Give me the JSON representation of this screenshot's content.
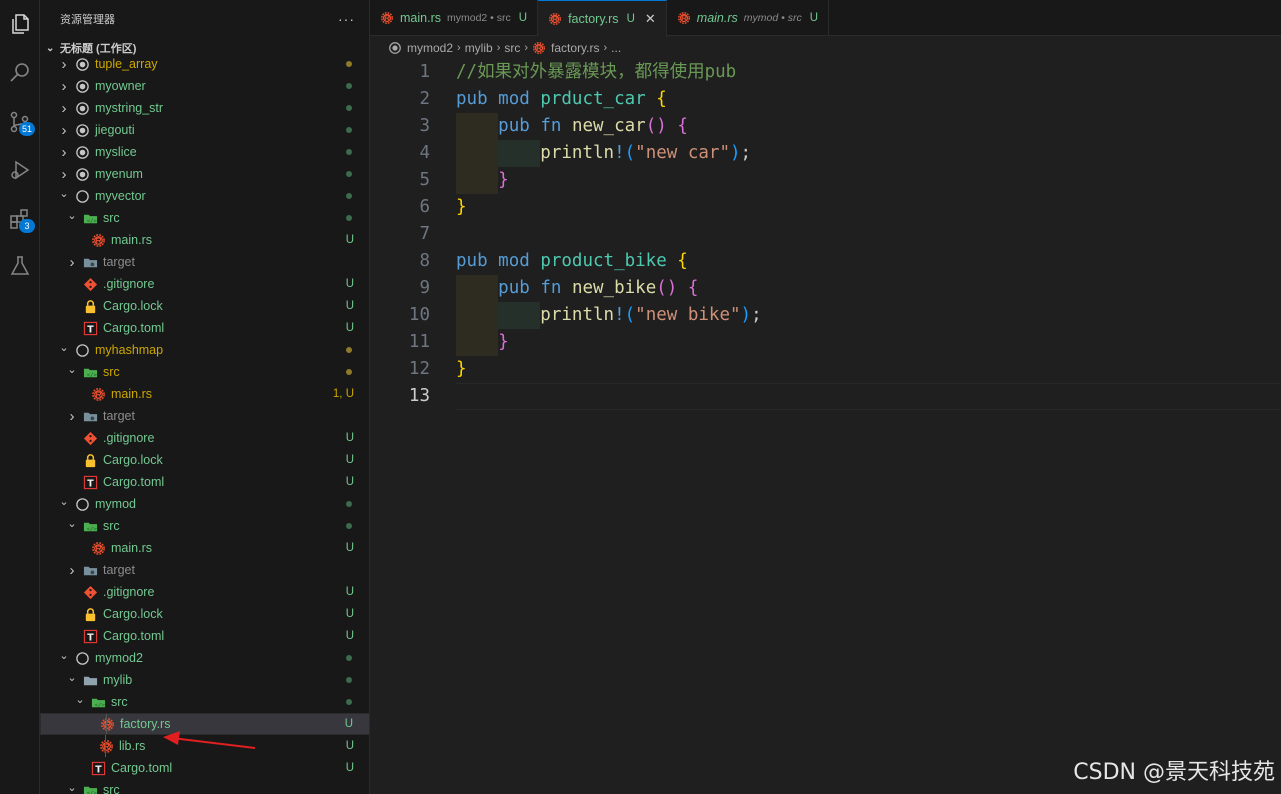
{
  "sidebar": {
    "title": "资源管理器",
    "more": "···",
    "workspace": "无标题 (工作区)",
    "tree": [
      {
        "label": "tuple_array",
        "depth": 0,
        "arrow": "right",
        "icon": "crate",
        "color": "yellow",
        "status": "",
        "dot": "yellow"
      },
      {
        "label": "myowner",
        "depth": 0,
        "arrow": "right",
        "icon": "crate",
        "color": "green",
        "status": "",
        "dot": "green"
      },
      {
        "label": "mystring_str",
        "depth": 0,
        "arrow": "right",
        "icon": "crate",
        "color": "green",
        "status": "",
        "dot": "green"
      },
      {
        "label": "jiegouti",
        "depth": 0,
        "arrow": "right",
        "icon": "crate",
        "color": "green",
        "status": "",
        "dot": "green"
      },
      {
        "label": "myslice",
        "depth": 0,
        "arrow": "right",
        "icon": "crate",
        "color": "green",
        "status": "",
        "dot": "green"
      },
      {
        "label": "myenum",
        "depth": 0,
        "arrow": "right",
        "icon": "crate",
        "color": "green",
        "status": "",
        "dot": "green"
      },
      {
        "label": "myvector",
        "depth": 0,
        "arrow": "down",
        "icon": "crate-open",
        "color": "green",
        "status": "",
        "dot": "green"
      },
      {
        "label": "src",
        "depth": 1,
        "arrow": "down",
        "icon": "folder-src",
        "color": "green",
        "status": "",
        "dot": "green"
      },
      {
        "label": "main.rs",
        "depth": 2,
        "arrow": "",
        "icon": "rust",
        "color": "green",
        "status": "U",
        "dot": ""
      },
      {
        "label": "target",
        "depth": 1,
        "arrow": "right",
        "icon": "folder-target",
        "color": "gray",
        "status": "",
        "dot": ""
      },
      {
        "label": ".gitignore",
        "depth": 1,
        "arrow": "",
        "icon": "git",
        "color": "green",
        "status": "U",
        "dot": ""
      },
      {
        "label": "Cargo.lock",
        "depth": 1,
        "arrow": "",
        "icon": "lock",
        "color": "green",
        "status": "U",
        "dot": ""
      },
      {
        "label": "Cargo.toml",
        "depth": 1,
        "arrow": "",
        "icon": "toml",
        "color": "green",
        "status": "U",
        "dot": ""
      },
      {
        "label": "myhashmap",
        "depth": 0,
        "arrow": "down",
        "icon": "crate-open",
        "color": "yellow",
        "status": "",
        "dot": "yellow"
      },
      {
        "label": "src",
        "depth": 1,
        "arrow": "down",
        "icon": "folder-src",
        "color": "yellow",
        "status": "",
        "dot": "yellow"
      },
      {
        "label": "main.rs",
        "depth": 2,
        "arrow": "",
        "icon": "rust",
        "color": "yellow",
        "status": "1, U",
        "dot": ""
      },
      {
        "label": "target",
        "depth": 1,
        "arrow": "right",
        "icon": "folder-target",
        "color": "gray",
        "status": "",
        "dot": ""
      },
      {
        "label": ".gitignore",
        "depth": 1,
        "arrow": "",
        "icon": "git",
        "color": "green",
        "status": "U",
        "dot": ""
      },
      {
        "label": "Cargo.lock",
        "depth": 1,
        "arrow": "",
        "icon": "lock",
        "color": "green",
        "status": "U",
        "dot": ""
      },
      {
        "label": "Cargo.toml",
        "depth": 1,
        "arrow": "",
        "icon": "toml",
        "color": "green",
        "status": "U",
        "dot": ""
      },
      {
        "label": "mymod",
        "depth": 0,
        "arrow": "down",
        "icon": "crate-open",
        "color": "green",
        "status": "",
        "dot": "green"
      },
      {
        "label": "src",
        "depth": 1,
        "arrow": "down",
        "icon": "folder-src",
        "color": "green",
        "status": "",
        "dot": "green"
      },
      {
        "label": "main.rs",
        "depth": 2,
        "arrow": "",
        "icon": "rust",
        "color": "green",
        "status": "U",
        "dot": ""
      },
      {
        "label": "target",
        "depth": 1,
        "arrow": "right",
        "icon": "folder-target",
        "color": "gray",
        "status": "",
        "dot": ""
      },
      {
        "label": ".gitignore",
        "depth": 1,
        "arrow": "",
        "icon": "git",
        "color": "green",
        "status": "U",
        "dot": ""
      },
      {
        "label": "Cargo.lock",
        "depth": 1,
        "arrow": "",
        "icon": "lock",
        "color": "green",
        "status": "U",
        "dot": ""
      },
      {
        "label": "Cargo.toml",
        "depth": 1,
        "arrow": "",
        "icon": "toml",
        "color": "green",
        "status": "U",
        "dot": ""
      },
      {
        "label": "mymod2",
        "depth": 0,
        "arrow": "down",
        "icon": "crate-open",
        "color": "green",
        "status": "",
        "dot": "green"
      },
      {
        "label": "mylib",
        "depth": 1,
        "arrow": "down",
        "icon": "folder-open",
        "color": "green",
        "status": "",
        "dot": "green"
      },
      {
        "label": "src",
        "depth": 2,
        "arrow": "down",
        "icon": "folder-src",
        "color": "green",
        "status": "",
        "dot": "green"
      },
      {
        "label": "factory.rs",
        "depth": 3,
        "arrow": "",
        "icon": "rust",
        "color": "green",
        "status": "U",
        "dot": "",
        "selected": true
      },
      {
        "label": "lib.rs",
        "depth": 3,
        "arrow": "",
        "icon": "rust",
        "color": "green",
        "status": "U",
        "dot": ""
      },
      {
        "label": "Cargo.toml",
        "depth": 2,
        "arrow": "",
        "icon": "toml",
        "color": "green",
        "status": "U",
        "dot": ""
      },
      {
        "label": "src",
        "depth": 1,
        "arrow": "down",
        "icon": "folder-src",
        "color": "green",
        "status": "",
        "dot": ""
      }
    ]
  },
  "activity": {
    "scm_badge": "51",
    "ext_badge": "3"
  },
  "tabs": [
    {
      "label": "main.rs",
      "desc": "mymod2 • src",
      "status": "U",
      "active": false,
      "italic": false
    },
    {
      "label": "factory.rs",
      "desc": "",
      "status": "U",
      "active": true,
      "italic": false,
      "close": "✕"
    },
    {
      "label": "main.rs",
      "desc": "mymod • src",
      "status": "U",
      "active": false,
      "italic": true
    }
  ],
  "breadcrumb": [
    "mymod2",
    "mylib",
    "src",
    "factory.rs",
    "..."
  ],
  "editor": {
    "current_line": 13,
    "lines": [
      [
        {
          "t": "//如果对外暴露模块，都得使用pub",
          "c": "cm"
        }
      ],
      [
        {
          "t": "pub",
          "c": "k"
        },
        {
          "t": " "
        },
        {
          "t": "mod",
          "c": "k"
        },
        {
          "t": " "
        },
        {
          "t": "prduct_car",
          "c": "t"
        },
        {
          "t": " "
        },
        {
          "t": "{",
          "c": "b1"
        }
      ],
      [
        {
          "t": "    "
        },
        {
          "t": "pub",
          "c": "k"
        },
        {
          "t": " "
        },
        {
          "t": "fn",
          "c": "k"
        },
        {
          "t": " "
        },
        {
          "t": "new_car",
          "c": "f"
        },
        {
          "t": "()",
          "c": "b2"
        },
        {
          "t": " "
        },
        {
          "t": "{",
          "c": "b2"
        }
      ],
      [
        {
          "t": "        "
        },
        {
          "t": "println",
          "c": "f"
        },
        {
          "t": "!",
          "c": "mac"
        },
        {
          "t": "(",
          "c": "b3"
        },
        {
          "t": "\"new car\"",
          "c": "s"
        },
        {
          "t": ")",
          "c": "b3"
        },
        {
          "t": ";"
        }
      ],
      [
        {
          "t": "    "
        },
        {
          "t": "}",
          "c": "b2"
        }
      ],
      [
        {
          "t": "}",
          "c": "b1"
        }
      ],
      [],
      [
        {
          "t": "pub",
          "c": "k"
        },
        {
          "t": " "
        },
        {
          "t": "mod",
          "c": "k"
        },
        {
          "t": " "
        },
        {
          "t": "product_bike",
          "c": "t"
        },
        {
          "t": " "
        },
        {
          "t": "{",
          "c": "b1"
        }
      ],
      [
        {
          "t": "    "
        },
        {
          "t": "pub",
          "c": "k"
        },
        {
          "t": " "
        },
        {
          "t": "fn",
          "c": "k"
        },
        {
          "t": " "
        },
        {
          "t": "new_bike",
          "c": "f"
        },
        {
          "t": "()",
          "c": "b2"
        },
        {
          "t": " "
        },
        {
          "t": "{",
          "c": "b2"
        }
      ],
      [
        {
          "t": "        "
        },
        {
          "t": "println",
          "c": "f"
        },
        {
          "t": "!",
          "c": "mac"
        },
        {
          "t": "(",
          "c": "b3"
        },
        {
          "t": "\"new bike\"",
          "c": "s"
        },
        {
          "t": ")",
          "c": "b3"
        },
        {
          "t": ";"
        }
      ],
      [
        {
          "t": "    "
        },
        {
          "t": "}",
          "c": "b2"
        }
      ],
      [
        {
          "t": "}",
          "c": "b1"
        }
      ],
      []
    ]
  },
  "watermark": "CSDN @景天科技苑",
  "colors": {
    "accent": "#0078d4",
    "untracked": "#73c991",
    "warning": "#cca700",
    "annotation_arrow": "#e02020"
  }
}
